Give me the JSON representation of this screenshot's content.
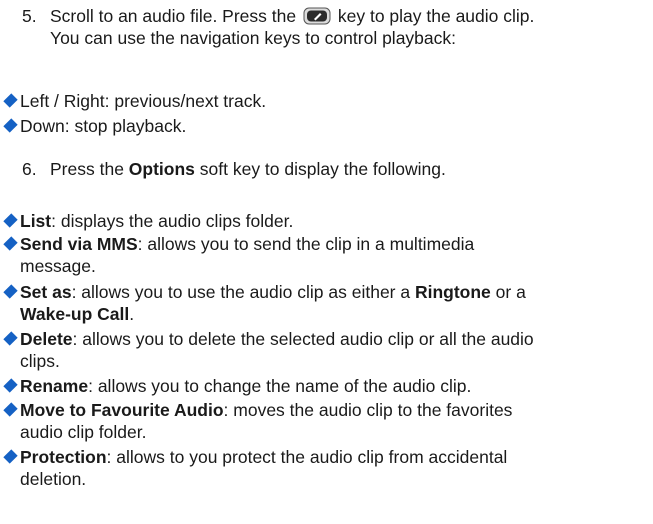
{
  "step5": {
    "number": "5.",
    "line1_before": "Scroll to an audio file. Press the",
    "line1_after": "key to play the audio clip.",
    "line2": "You can use the navigation keys to control playback:",
    "key_icon": "center-select-key-icon"
  },
  "nav_bullets": [
    {
      "text": "Left / Right: previous/next track."
    },
    {
      "text": "Down: stop playback."
    }
  ],
  "step6": {
    "number": "6.",
    "before": "Press the ",
    "bold": "Options",
    "after": " soft key to display the following."
  },
  "options": {
    "list": {
      "term": "List",
      "desc": ": displays the audio clips folder."
    },
    "send": {
      "term": "Send via MMS",
      "desc1": ": allows you to send the clip in a multimedia",
      "desc2": "message."
    },
    "setas": {
      "term": "Set as",
      "desc1": ": allows you to use the audio clip as either a ",
      "ringtone": "Ringtone",
      "or": " or a",
      "wakeup": "Wake-up Call",
      "end": "."
    },
    "delete": {
      "term": "Delete",
      "desc1": ": allows you to delete the selected audio clip or all the audio",
      "desc2": "clips."
    },
    "rename": {
      "term": "Rename",
      "desc": ": allows you to change the name of the audio clip."
    },
    "move": {
      "term": "Move to Favourite Audio",
      "desc1": ": moves the audio clip to the favorites",
      "desc2": "audio clip folder."
    },
    "protection": {
      "term": "Protection",
      "desc1": ": allows to you protect the audio clip from accidental",
      "desc2": "deletion."
    }
  },
  "colors": {
    "bullet": "#1561c4",
    "text": "#1a1a1a"
  }
}
